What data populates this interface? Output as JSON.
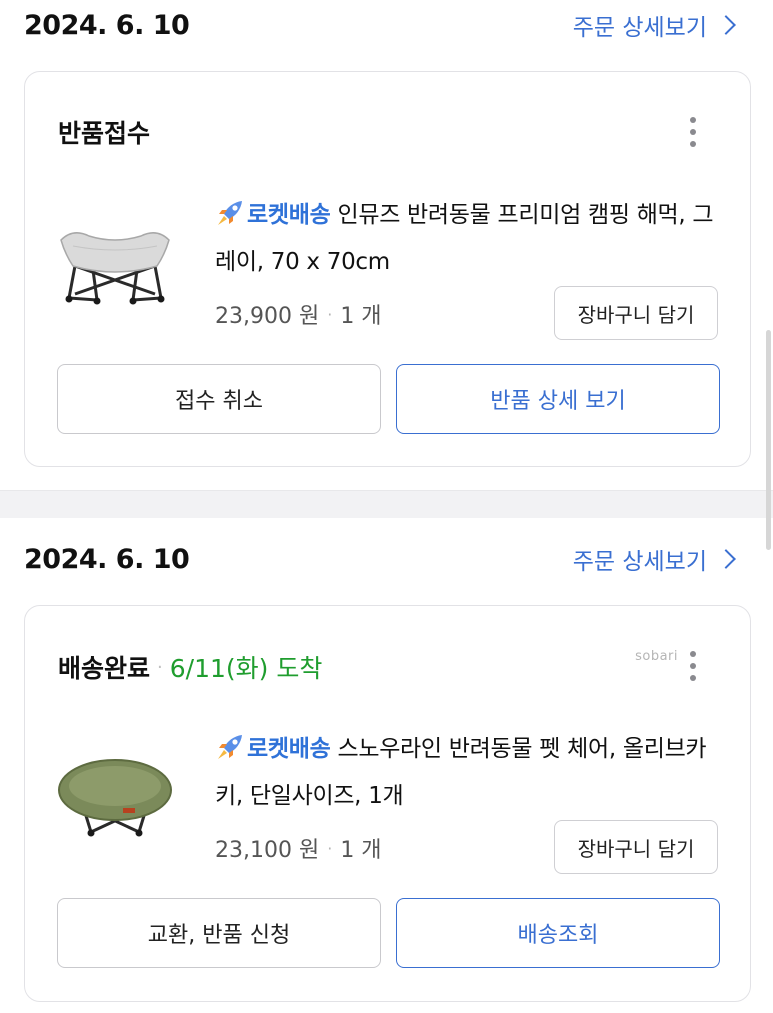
{
  "orders": [
    {
      "date": "2024. 6. 10",
      "detail_link": "주문 상세보기",
      "status": "반품접수",
      "arrival": "",
      "rocket_label": "로켓배송",
      "product_name": "인뮤즈 반려동물 프리미엄 캠핑 해먹, 그레이, 70 x 70cm",
      "price": "23,900 원",
      "quantity": "1 개",
      "cart_button": "장바구니 담기",
      "left_button": "접수 취소",
      "right_button": "반품 상세 보기"
    },
    {
      "date": "2024. 6. 10",
      "detail_link": "주문 상세보기",
      "status": "배송완료",
      "arrival": "6/11(화) 도착",
      "watermark": "sobari",
      "rocket_label": "로켓배송",
      "product_name": "스노우라인 반려동물 펫 체어, 올리브카키, 단일사이즈, 1개",
      "price": "23,100 원",
      "quantity": "1 개",
      "cart_button": "장바구니 담기",
      "left_button": "교환, 반품 신청",
      "right_button": "배송조회"
    }
  ],
  "icons": {
    "rocket": "rocket-icon",
    "more": "kebab-menu-icon",
    "chevron": "chevron-right-icon"
  },
  "colors": {
    "accent_blue": "#3a6fd1",
    "rocket_blue": "#2f72d8",
    "arrival_green": "#1f9d2e"
  }
}
